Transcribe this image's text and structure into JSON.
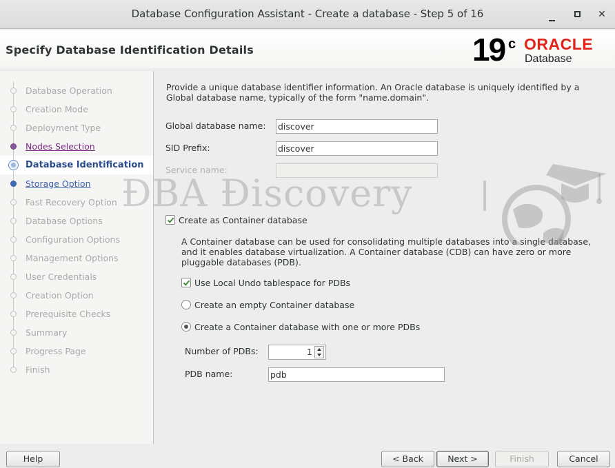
{
  "window": {
    "title": "Database Configuration Assistant - Create a database - Step 5 of 16",
    "controls": [
      "minimize",
      "maximize",
      "close"
    ]
  },
  "header": {
    "page_title": "Specify Database Identification Details",
    "logo": {
      "version": "19",
      "version_suffix": "c",
      "brand": "ORACLE",
      "product": "Database",
      "brand_color": "#e2231a"
    }
  },
  "sidebar": {
    "steps": [
      {
        "label": "Database Operation",
        "state": "done"
      },
      {
        "label": "Creation Mode",
        "state": "done"
      },
      {
        "label": "Deployment Type",
        "state": "done"
      },
      {
        "label": "Nodes Selection",
        "state": "link"
      },
      {
        "label": "Database Identification",
        "state": "current"
      },
      {
        "label": "Storage Option",
        "state": "link"
      },
      {
        "label": "Fast Recovery Option",
        "state": "pending"
      },
      {
        "label": "Database Options",
        "state": "pending"
      },
      {
        "label": "Configuration Options",
        "state": "pending"
      },
      {
        "label": "Management Options",
        "state": "pending"
      },
      {
        "label": "User Credentials",
        "state": "pending"
      },
      {
        "label": "Creation Option",
        "state": "pending"
      },
      {
        "label": "Prerequisite Checks",
        "state": "pending"
      },
      {
        "label": "Summary",
        "state": "pending"
      },
      {
        "label": "Progress Page",
        "state": "pending"
      },
      {
        "label": "Finish",
        "state": "pending"
      }
    ]
  },
  "main": {
    "intro": "Provide a unique database identifier information. An Oracle database is uniquely identified by a Global database name, typically of the form \"name.domain\".",
    "global_db_name": {
      "label": "Global database name:",
      "value": "discover"
    },
    "sid_prefix": {
      "label": "SID Prefix:",
      "value": "discover"
    },
    "service_name": {
      "label": "Service name:",
      "value": "",
      "enabled": false
    },
    "container_checkbox": {
      "label": "Create as Container database",
      "checked": true
    },
    "container_desc": "A Container database can be used for consolidating multiple databases into a single database, and it enables database virtualization. A Container database (CDB) can have zero or more pluggable databases (PDB).",
    "local_undo": {
      "label": "Use Local Undo tablespace for PDBs",
      "checked": true
    },
    "radio_empty": {
      "label": "Create an empty Container database",
      "selected": false
    },
    "radio_with_pdbs": {
      "label": "Create a Container database with one or more PDBs",
      "selected": true
    },
    "num_pdbs": {
      "label": "Number of PDBs:",
      "value": "1"
    },
    "pdb_name": {
      "label": "PDB name:",
      "value": "pdb"
    }
  },
  "watermark": {
    "text": "ÐBA Ðiscovery"
  },
  "buttons": {
    "help": "Help",
    "back": "< Back",
    "next": "Next >",
    "finish": "Finish",
    "cancel": "Cancel"
  }
}
